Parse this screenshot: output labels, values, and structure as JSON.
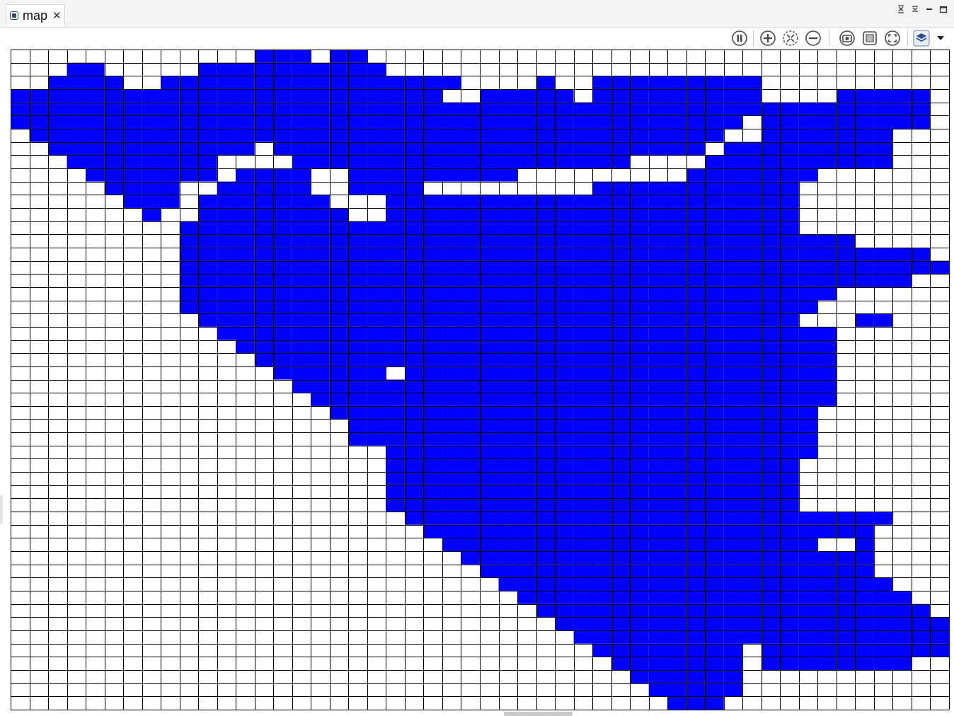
{
  "tab": {
    "label": "map",
    "close_glyph": "✕",
    "icon": "map-view-icon"
  },
  "window_controls": [
    "restore-icon",
    "restore-all-icon",
    "minimize-icon",
    "maximize-icon"
  ],
  "toolbar": {
    "buttons": [
      {
        "name": "pause-button",
        "icon": "pause-icon"
      },
      {
        "name": "zoom-in-button",
        "icon": "zoom-in-icon"
      },
      {
        "name": "zoom-fit-button",
        "icon": "zoom-fit-icon"
      },
      {
        "name": "zoom-out-button",
        "icon": "zoom-out-icon"
      },
      {
        "name": "snapshot-button",
        "icon": "camera-icon"
      },
      {
        "name": "overlay-button",
        "icon": "overlay-icon"
      },
      {
        "name": "fullscreen-button",
        "icon": "fullscreen-icon"
      },
      {
        "name": "layers-button",
        "icon": "layers-icon"
      },
      {
        "name": "layers-menu-button",
        "icon": "dropdown-arrow-icon"
      }
    ]
  },
  "colors": {
    "filled": "#0000ff",
    "empty": "#ffffff",
    "gridline": "#000000",
    "icon": "#4a4a4a",
    "layer_icon": "#2a4f8f"
  },
  "map": {
    "cols": 50,
    "rows": 50,
    "cells": [
      "..............##...##.............................",
      "...##.........########............................",
      "..####..##################.....#..##..............",
      "########################..####################....",
      "###################################################",
      "############################################.#######",
      "...............................................",
      "..",
      "..",
      "..",
      ".",
      ".",
      ".",
      ".",
      ".",
      ".",
      ".",
      ".",
      ".",
      ".",
      ".",
      ".",
      ".",
      ".",
      ".",
      ".",
      ".",
      ".",
      ".",
      ".",
      ".",
      ".",
      ".",
      ".",
      ".",
      ".",
      ".",
      ".",
      ".",
      ".",
      ".",
      ".",
      ".",
      ".",
      ".",
      ".",
      ".",
      ".",
      ".",
      "."
    ]
  }
}
